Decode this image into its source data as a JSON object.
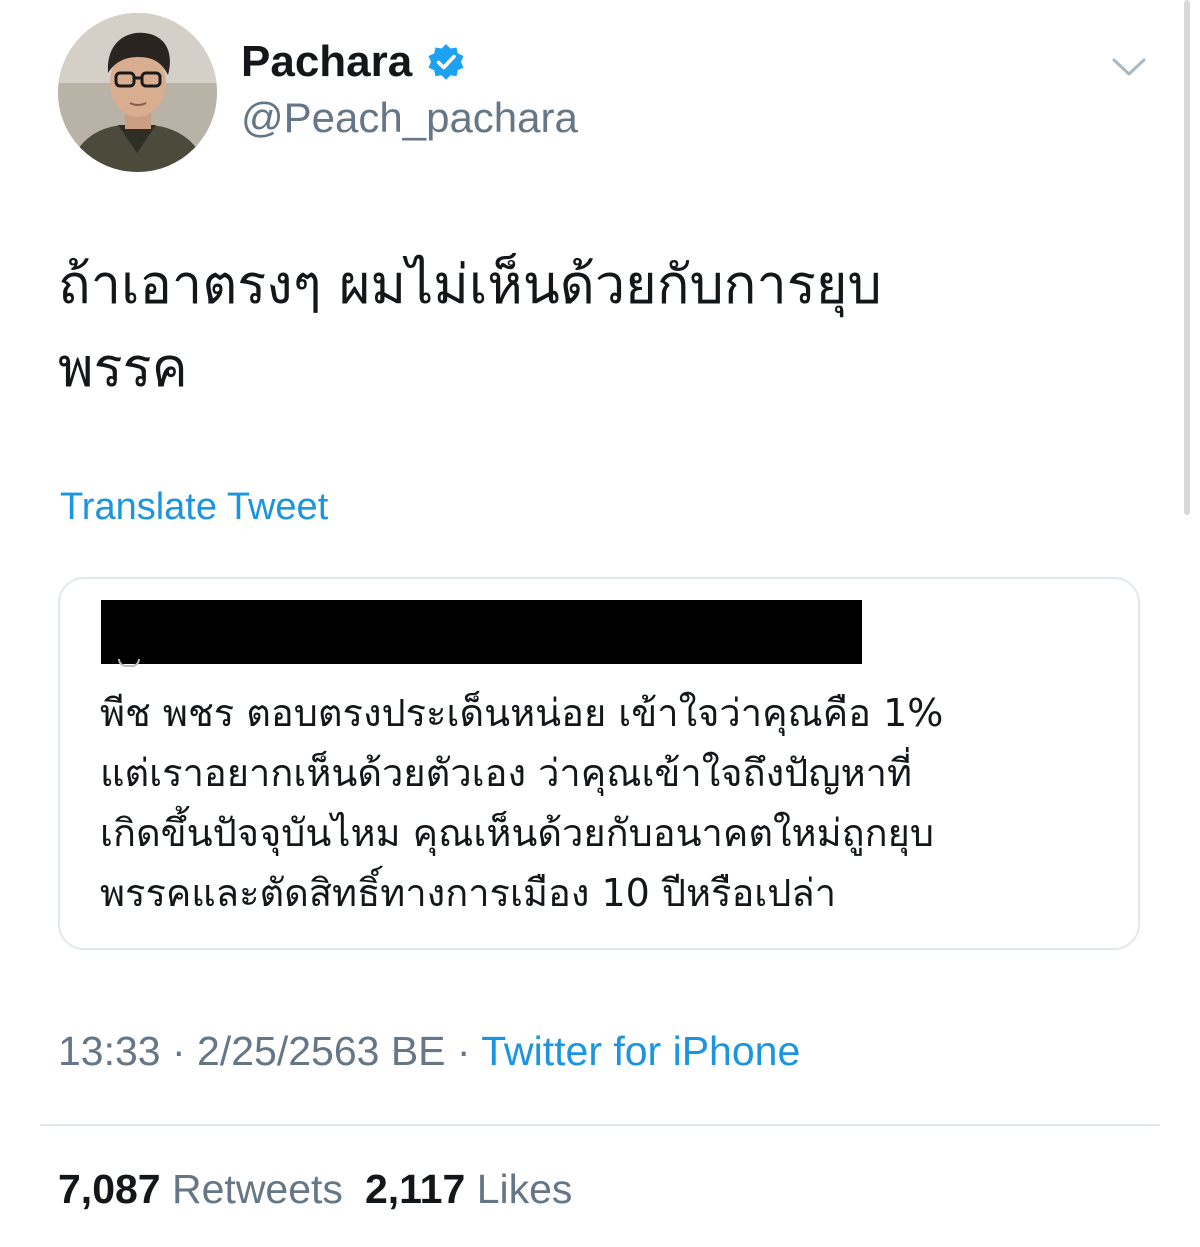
{
  "user": {
    "display_name": "Pachara",
    "handle": "@Peach_pachara",
    "verified": true
  },
  "tweet": {
    "text_lines": [
      "ถ้าเอาตรงๆ ผมไม่เห็นด้วยกับการยุบ",
      "พรรค"
    ],
    "translate_label": "Translate Tweet"
  },
  "quoted_tweet": {
    "author_redacted": true,
    "text_lines": [
      "พีช พชร ตอบตรงประเด็นหน่อย เข้าใจว่าคุณคือ 1%",
      "แต่เราอยากเห็นด้วยตัวเอง ว่าคุณเข้าใจถึงปัญหาที่",
      "เกิดขึ้นปัจจุบันไหม คุณเห็นด้วยกับอนาคตใหม่ถูกยุบ",
      "พรรคและตัดสิทธิ์ทางการเมือง 10 ปีหรือเปล่า"
    ]
  },
  "meta": {
    "time": "13:33",
    "separator": " · ",
    "date": "2/25/2563 BE",
    "source": "Twitter for iPhone"
  },
  "stats": {
    "retweets_count": "7,087",
    "retweets_label": "Retweets",
    "likes_count": "2,117",
    "likes_label": "Likes"
  },
  "colors": {
    "link_blue": "#1b95e0",
    "secondary_gray": "#657786",
    "primary_text": "#14171a",
    "border": "#e1e8ed"
  },
  "icons": {
    "verified": "verified-badge-icon",
    "menu": "chevron-down-icon"
  }
}
